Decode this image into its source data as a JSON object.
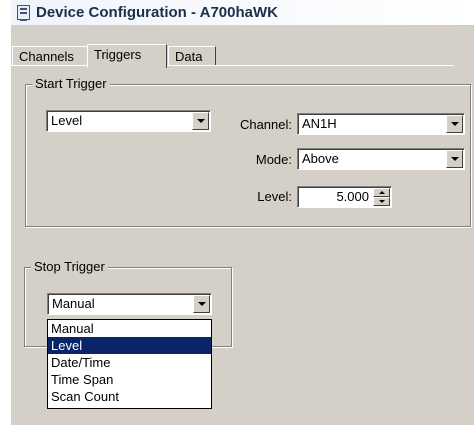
{
  "window": {
    "title": "Device Configuration - A700haWK"
  },
  "tabs": [
    {
      "label": "Channels"
    },
    {
      "label": "Triggers"
    },
    {
      "label": "Data"
    }
  ],
  "start_trigger": {
    "legend": "Start Trigger",
    "type_value": "Level",
    "channel_label": "Channel:",
    "channel_value": "AN1H",
    "mode_label": "Mode:",
    "mode_value": "Above",
    "level_label": "Level:",
    "level_value": "5.000"
  },
  "stop_trigger": {
    "legend": "Stop Trigger",
    "type_value": "Manual",
    "options": [
      "Manual",
      "Level",
      "Date/Time",
      "Time Span",
      "Scan Count"
    ],
    "highlighted_option": "Level"
  }
}
